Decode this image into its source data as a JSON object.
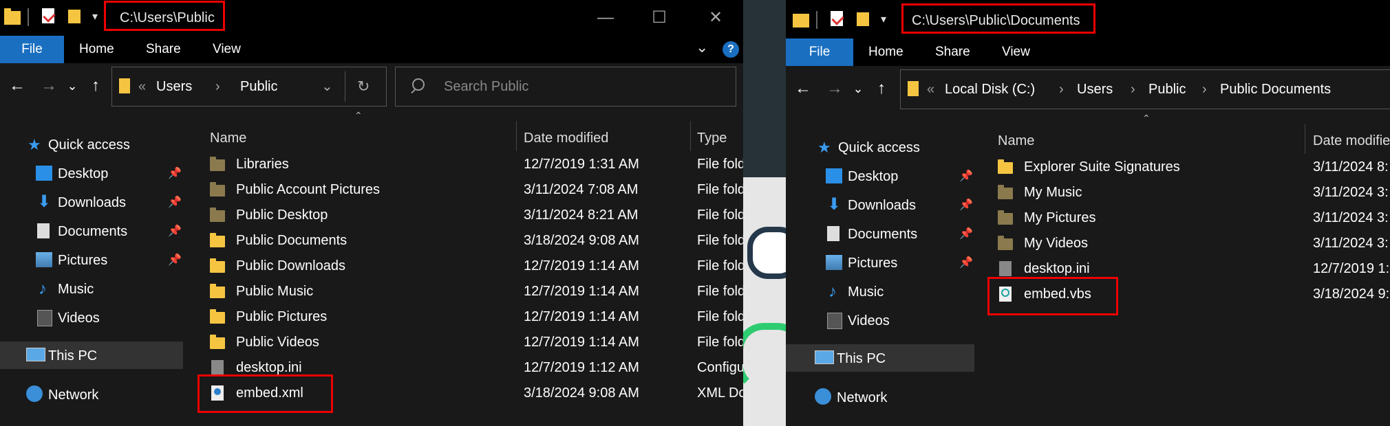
{
  "left": {
    "title_path": "C:\\Users\\Public",
    "ribbon": {
      "file": "File",
      "home": "Home",
      "share": "Share",
      "view": "View"
    },
    "breadcrumb": [
      "«",
      "Users",
      "Public"
    ],
    "search_placeholder": "Search Public",
    "sidebar": {
      "quick_access": "Quick access",
      "items": [
        "Desktop",
        "Downloads",
        "Documents",
        "Pictures",
        "Music",
        "Videos"
      ],
      "this_pc": "This PC",
      "network": "Network"
    },
    "columns": {
      "name": "Name",
      "date": "Date modified",
      "type": "Type"
    },
    "rows": [
      {
        "name": "Libraries",
        "date": "12/7/2019 1:31 AM",
        "type": "File folder"
      },
      {
        "name": "Public Account Pictures",
        "date": "3/11/2024 7:08 AM",
        "type": "File folder"
      },
      {
        "name": "Public Desktop",
        "date": "3/11/2024 8:21 AM",
        "type": "File folder"
      },
      {
        "name": "Public Documents",
        "date": "3/18/2024 9:08 AM",
        "type": "File folder"
      },
      {
        "name": "Public Downloads",
        "date": "12/7/2019 1:14 AM",
        "type": "File folder"
      },
      {
        "name": "Public Music",
        "date": "12/7/2019 1:14 AM",
        "type": "File folder"
      },
      {
        "name": "Public Pictures",
        "date": "12/7/2019 1:14 AM",
        "type": "File folder"
      },
      {
        "name": "Public Videos",
        "date": "12/7/2019 1:14 AM",
        "type": "File folder"
      },
      {
        "name": "desktop.ini",
        "date": "12/7/2019 1:12 AM",
        "type": "Configuration settings"
      },
      {
        "name": "embed.xml",
        "date": "3/18/2024 9:08 AM",
        "type": "XML Document"
      }
    ]
  },
  "right": {
    "title_path": "C:\\Users\\Public\\Documents",
    "ribbon": {
      "file": "File",
      "home": "Home",
      "share": "Share",
      "view": "View"
    },
    "breadcrumb": [
      "«",
      "Local Disk (C:)",
      "Users",
      "Public",
      "Public Documents"
    ],
    "sidebar": {
      "quick_access": "Quick access",
      "items": [
        "Desktop",
        "Downloads",
        "Documents",
        "Pictures",
        "Music",
        "Videos"
      ],
      "this_pc": "This PC",
      "network": "Network"
    },
    "columns": {
      "name": "Name",
      "date": "Date modified"
    },
    "rows": [
      {
        "name": "Explorer Suite Signatures",
        "date": "3/11/2024 8:"
      },
      {
        "name": "My Music",
        "date": "3/11/2024 3:"
      },
      {
        "name": "My Pictures",
        "date": "3/11/2024 3:"
      },
      {
        "name": "My Videos",
        "date": "3/11/2024 3:"
      },
      {
        "name": "desktop.ini",
        "date": "12/7/2019 1:"
      },
      {
        "name": "embed.vbs",
        "date": "3/18/2024 9:"
      }
    ]
  },
  "colors": {
    "accent": "#1a6fc1",
    "highlight": "#ee0000",
    "folder": "#f5c542"
  },
  "icons": {
    "quick_access": "star-icon",
    "desktop": "desktop-icon",
    "downloads": "download-arrow-icon",
    "documents": "document-icon",
    "pictures": "picture-icon",
    "music": "music-note-icon",
    "videos": "film-icon",
    "this_pc": "computer-icon",
    "network": "globe-network-icon"
  }
}
